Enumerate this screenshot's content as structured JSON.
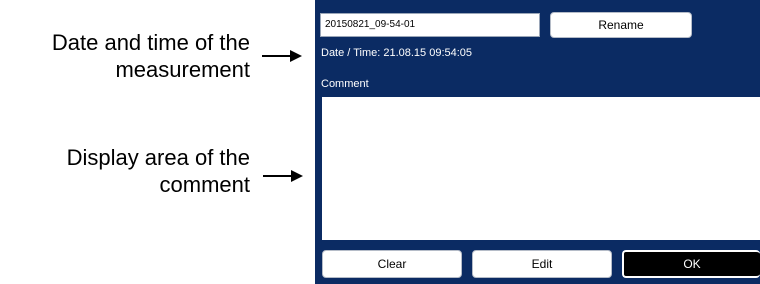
{
  "callouts": {
    "datetime": [
      "Date and time of the",
      "measurement"
    ],
    "comment": [
      "Display area of the",
      "comment"
    ]
  },
  "device": {
    "filename": "20150821_09-54-01",
    "rename_label": "Rename",
    "datetime_text": "Date / Time: 21.08.15 09:54:05",
    "comment_label": "Comment",
    "comment_text": "",
    "clear_label": "Clear",
    "edit_label": "Edit",
    "ok_label": "OK"
  },
  "colors": {
    "panel_background": "#0b2b63",
    "ok_button_background": "#000000"
  }
}
